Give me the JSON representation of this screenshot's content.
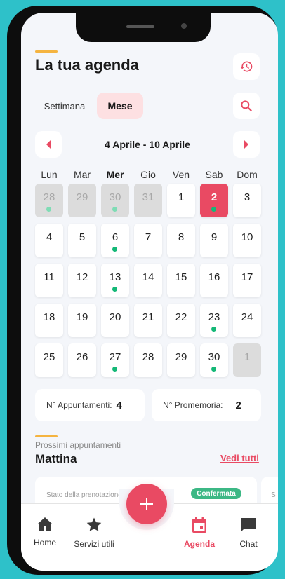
{
  "header": {
    "title": "La tua agenda"
  },
  "view_toggle": {
    "week_label": "Settimana",
    "month_label": "Mese"
  },
  "week_nav": {
    "range": "4 Aprile - 10 Aprile"
  },
  "weekdays": [
    "Lun",
    "Mar",
    "Mer",
    "Gio",
    "Ven",
    "Sab",
    "Dom"
  ],
  "calendar": {
    "weeks": [
      [
        {
          "n": "28",
          "muted": true,
          "dot": true
        },
        {
          "n": "29",
          "muted": true
        },
        {
          "n": "30",
          "muted": true,
          "dot": true
        },
        {
          "n": "31",
          "muted": true
        },
        {
          "n": "1"
        },
        {
          "n": "2",
          "selected": true,
          "dot": true
        },
        {
          "n": "3"
        }
      ],
      [
        {
          "n": "4"
        },
        {
          "n": "5"
        },
        {
          "n": "6",
          "dot": true
        },
        {
          "n": "7"
        },
        {
          "n": "8"
        },
        {
          "n": "9"
        },
        {
          "n": "10"
        }
      ],
      [
        {
          "n": "11"
        },
        {
          "n": "12"
        },
        {
          "n": "13",
          "dot": true
        },
        {
          "n": "14"
        },
        {
          "n": "15"
        },
        {
          "n": "16"
        },
        {
          "n": "17"
        }
      ],
      [
        {
          "n": "18"
        },
        {
          "n": "19"
        },
        {
          "n": "20"
        },
        {
          "n": "21"
        },
        {
          "n": "22"
        },
        {
          "n": "23",
          "dot": true
        },
        {
          "n": "24"
        }
      ],
      [
        {
          "n": "25"
        },
        {
          "n": "26"
        },
        {
          "n": "27",
          "dot": true
        },
        {
          "n": "28"
        },
        {
          "n": "29"
        },
        {
          "n": "30",
          "dot": true
        },
        {
          "n": "1",
          "muted": true
        }
      ]
    ]
  },
  "stats": {
    "appointments_label": "N° Appuntamenti:",
    "appointments_value": "4",
    "reminders_label": "N° Promemoria:",
    "reminders_value": "2"
  },
  "upcoming": {
    "sub_label": "Prossimi appuntamenti",
    "section_title": "Mattina",
    "see_all": "Vedi tutti",
    "card": {
      "status_label": "Stato della prenotazione:",
      "status_badge": "Confermata"
    },
    "next_card_label": "S"
  },
  "nav": {
    "items": [
      {
        "label": "Home",
        "icon": "home-icon"
      },
      {
        "label": "Servizi utili",
        "icon": "star-icon"
      },
      {
        "label": "Agenda",
        "icon": "calendar-icon",
        "active": true
      },
      {
        "label": "Chat",
        "icon": "chat-icon"
      }
    ],
    "fab_icon": "plus-icon"
  },
  "colors": {
    "accent": "#e94a63",
    "event_dot": "#14b877",
    "status_badge": "#3cb885",
    "underline": "#f5b440",
    "background": "#2ec1c9"
  }
}
